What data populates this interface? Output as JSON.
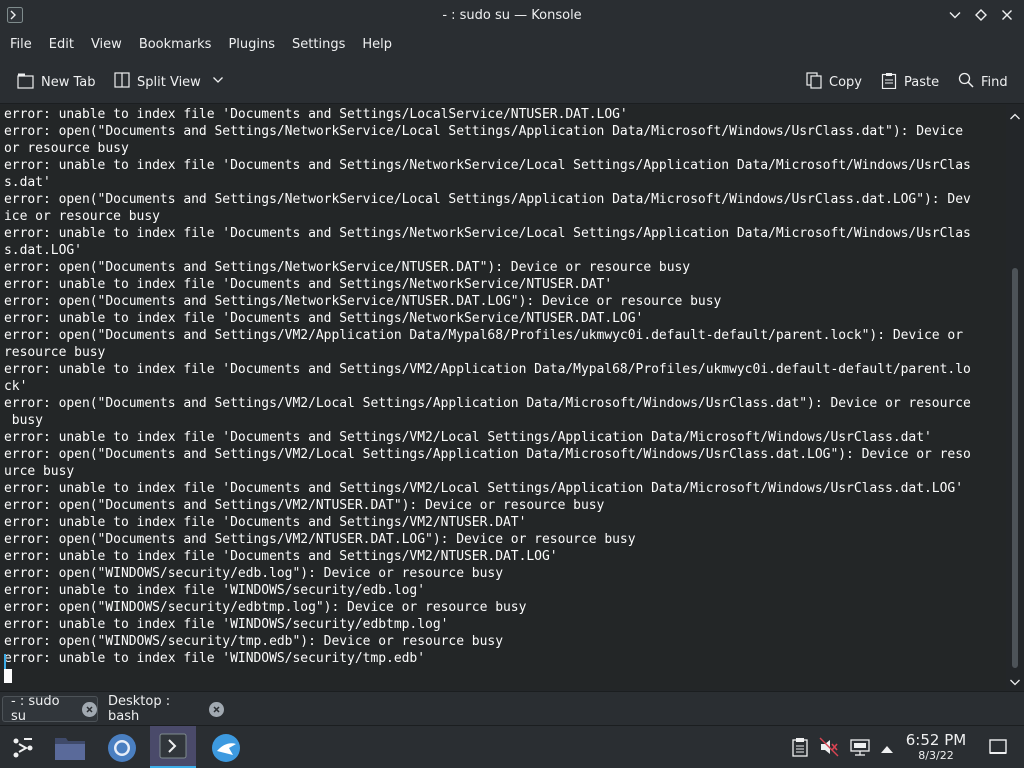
{
  "window": {
    "title": "- : sudo su — Konsole"
  },
  "menubar": {
    "items": [
      "File",
      "Edit",
      "View",
      "Bookmarks",
      "Plugins",
      "Settings",
      "Help"
    ]
  },
  "toolbar": {
    "new_tab": "New Tab",
    "split_view": "Split View",
    "copy": "Copy",
    "paste": "Paste",
    "find": "Find"
  },
  "terminal": {
    "lines": [
      "error: unable to index file 'Documents and Settings/LocalService/NTUSER.DAT.LOG'",
      "error: open(\"Documents and Settings/NetworkService/Local Settings/Application Data/Microsoft/Windows/UsrClass.dat\"): Device",
      "or resource busy",
      "error: unable to index file 'Documents and Settings/NetworkService/Local Settings/Application Data/Microsoft/Windows/UsrClas",
      "s.dat'",
      "error: open(\"Documents and Settings/NetworkService/Local Settings/Application Data/Microsoft/Windows/UsrClass.dat.LOG\"): Dev",
      "ice or resource busy",
      "error: unable to index file 'Documents and Settings/NetworkService/Local Settings/Application Data/Microsoft/Windows/UsrClas",
      "s.dat.LOG'",
      "error: open(\"Documents and Settings/NetworkService/NTUSER.DAT\"): Device or resource busy",
      "error: unable to index file 'Documents and Settings/NetworkService/NTUSER.DAT'",
      "error: open(\"Documents and Settings/NetworkService/NTUSER.DAT.LOG\"): Device or resource busy",
      "error: unable to index file 'Documents and Settings/NetworkService/NTUSER.DAT.LOG'",
      "error: open(\"Documents and Settings/VM2/Application Data/Mypal68/Profiles/ukmwyc0i.default-default/parent.lock\"): Device or",
      "resource busy",
      "error: unable to index file 'Documents and Settings/VM2/Application Data/Mypal68/Profiles/ukmwyc0i.default-default/parent.lo",
      "ck'",
      "error: open(\"Documents and Settings/VM2/Local Settings/Application Data/Microsoft/Windows/UsrClass.dat\"): Device or resource",
      " busy",
      "error: unable to index file 'Documents and Settings/VM2/Local Settings/Application Data/Microsoft/Windows/UsrClass.dat'",
      "error: open(\"Documents and Settings/VM2/Local Settings/Application Data/Microsoft/Windows/UsrClass.dat.LOG\"): Device or reso",
      "urce busy",
      "error: unable to index file 'Documents and Settings/VM2/Local Settings/Application Data/Microsoft/Windows/UsrClass.dat.LOG'",
      "error: open(\"Documents and Settings/VM2/NTUSER.DAT\"): Device or resource busy",
      "error: unable to index file 'Documents and Settings/VM2/NTUSER.DAT'",
      "error: open(\"Documents and Settings/VM2/NTUSER.DAT.LOG\"): Device or resource busy",
      "error: unable to index file 'Documents and Settings/VM2/NTUSER.DAT.LOG'",
      "error: open(\"WINDOWS/security/edb.log\"): Device or resource busy",
      "error: unable to index file 'WINDOWS/security/edb.log'",
      "error: open(\"WINDOWS/security/edbtmp.log\"): Device or resource busy",
      "error: unable to index file 'WINDOWS/security/edbtmp.log'",
      "error: open(\"WINDOWS/security/tmp.edb\"): Device or resource busy",
      "error: unable to index file 'WINDOWS/security/tmp.edb'"
    ]
  },
  "tabs": [
    {
      "label": "- : sudo su",
      "active": true
    },
    {
      "label": "Desktop : bash",
      "active": false
    }
  ],
  "taskbar": {
    "apps": [
      "application-launcher-icon",
      "file-manager-icon",
      "chromium-icon",
      "konsole-icon",
      "web-browser-icon"
    ],
    "clock": {
      "time": "6:52 PM",
      "date": "8/3/22"
    }
  },
  "colors": {
    "background": "#232627",
    "chrome": "#2a2e32",
    "text": "#fcfcfc",
    "accent": "#3daee9"
  }
}
